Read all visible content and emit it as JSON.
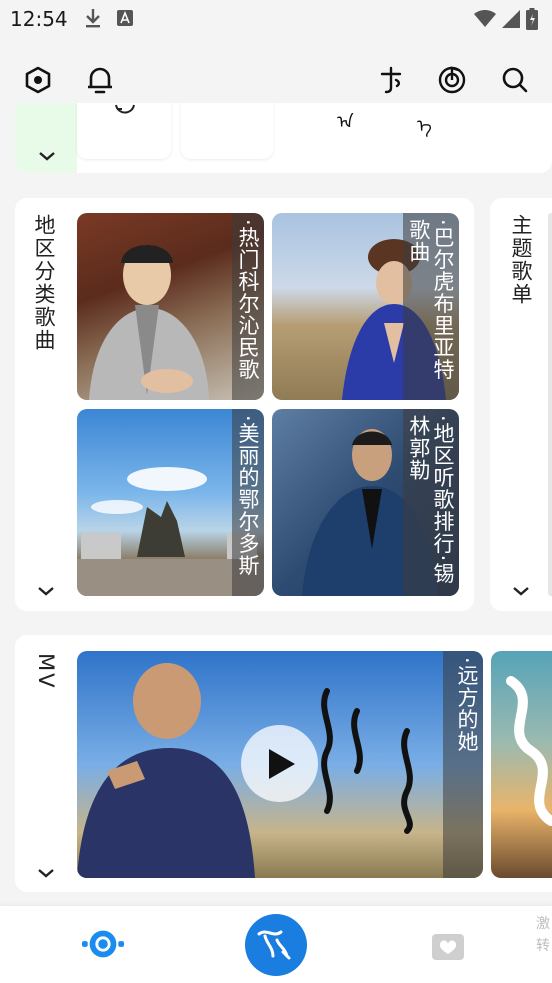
{
  "status": {
    "time": "12:54",
    "icons": [
      "download-icon",
      "a-notification-icon",
      "wifi-icon",
      "signal-icon",
      "battery-icon"
    ]
  },
  "toolbar": {
    "left": [
      "hexagon-settings-icon",
      "bell-icon"
    ],
    "right": [
      "mongolian-script-icon",
      "music-disc-icon",
      "search-icon"
    ]
  },
  "top_card": {
    "tile_labels": [
      "ᠠ",
      "ᠡ"
    ]
  },
  "regional": {
    "title": "地区分类歌曲",
    "tiles": [
      {
        "caption": "·热门科尔沁民歌"
      },
      {
        "caption": "·巴尔虎布里亚特歌曲"
      },
      {
        "caption": "·美丽的鄂尔多斯"
      },
      {
        "caption": "·地区听歌排行·锡林郭勒"
      }
    ]
  },
  "theme": {
    "title": "主题歌单"
  },
  "mv": {
    "title": "MV",
    "tiles": [
      {
        "caption": "·远方的她"
      }
    ]
  },
  "bottom_nav": {
    "right_label_line1": "激",
    "right_label_line2": "转"
  },
  "colors": {
    "accent": "#1a8cf0",
    "background": "#f4f4f4",
    "mint": "#e8fbe9"
  }
}
